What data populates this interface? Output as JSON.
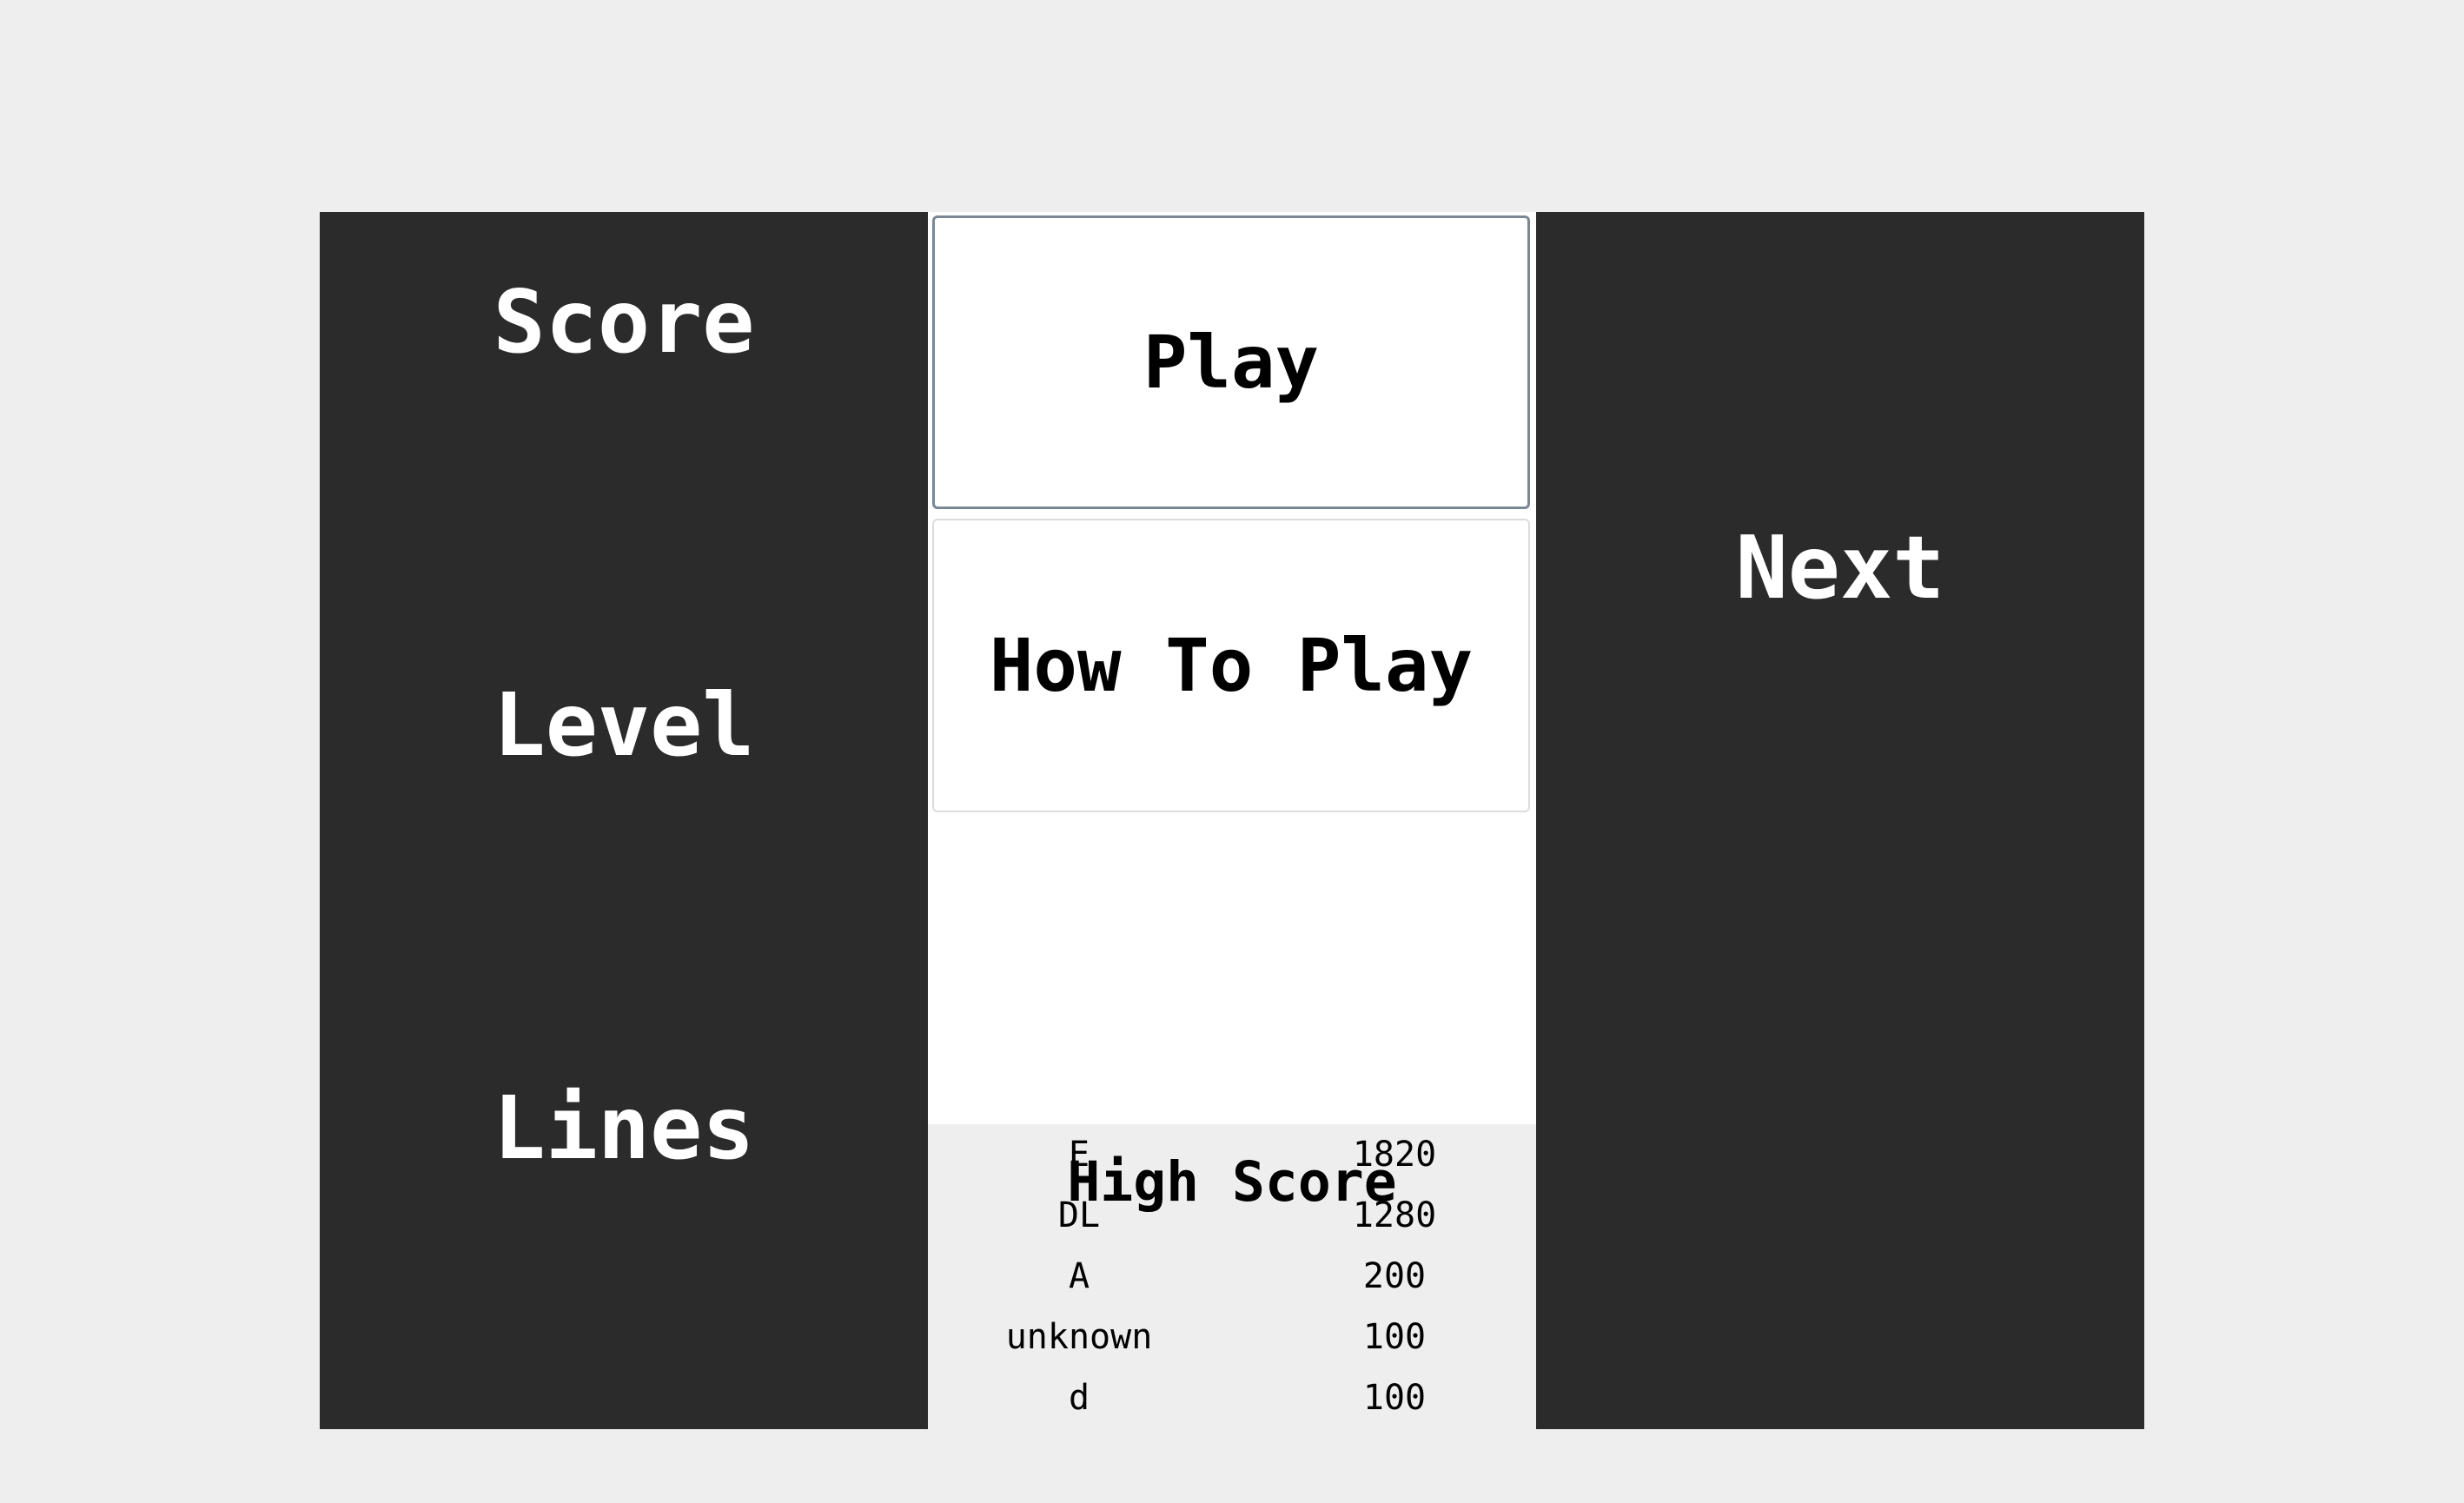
{
  "stats": {
    "score_label": "Score",
    "level_label": "Level",
    "lines_label": "Lines",
    "next_label": "Next"
  },
  "menu": {
    "play_label": "Play",
    "how_to_play_label": "How To Play"
  },
  "high_scores": {
    "title": "High Score",
    "entries": [
      {
        "name": "E",
        "score": "1820"
      },
      {
        "name": "DL",
        "score": "1280"
      },
      {
        "name": "A",
        "score": "200"
      },
      {
        "name": "unknown",
        "score": "100"
      },
      {
        "name": "d",
        "score": "100"
      }
    ]
  },
  "colors": {
    "background": "#eeeeee",
    "panel": "#2b2b2b",
    "panel_text": "#ffffff",
    "button_bg": "#ffffff",
    "button_text": "#000000"
  }
}
